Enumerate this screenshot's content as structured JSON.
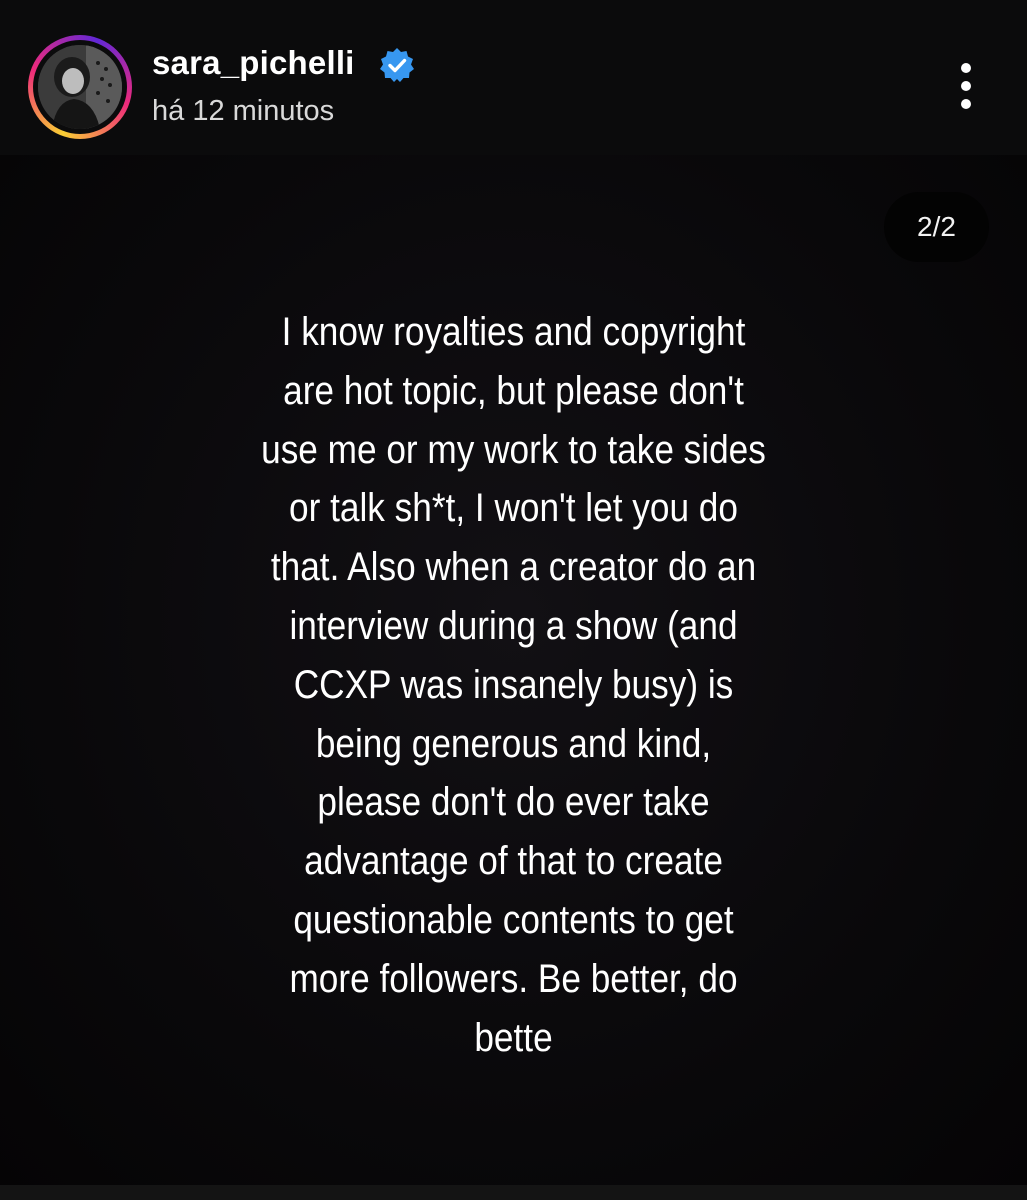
{
  "post_header": {
    "username": "sara_pichelli",
    "verified": true,
    "timestamp": "há 12 minutos",
    "avatar_icon": "profile-photo",
    "more_icon": "more-vertical-icon"
  },
  "story": {
    "counter": "2/2",
    "text": "I know royalties and copyright\nare hot topic, but please don't\nuse me or my work to take sides\nor talk sh*t, I won't let you do\nthat. Also when a creator do an\ninterview during a show (and\nCCXP was insanely busy) is\nbeing generous and kind,\nplease don't do ever take\nadvantage of that to create\nquestionable contents to get\nmore followers. Be better, do\nbette"
  },
  "colors": {
    "background": "#000000",
    "header_background": "#0b0b0c",
    "verified_badge": "#3797f0",
    "text": "#ffffff",
    "ring_gradient": [
      "#f9ce34",
      "#ee2a7b",
      "#6228d7"
    ]
  }
}
